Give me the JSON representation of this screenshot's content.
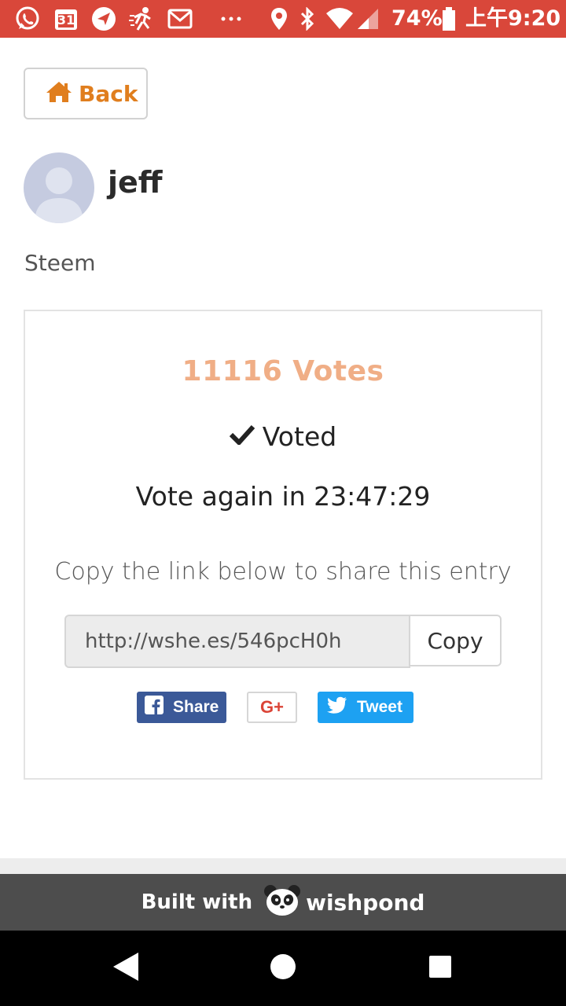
{
  "status_bar": {
    "calendar_day": "31",
    "battery": "74%",
    "time": "上午9:20",
    "icons": [
      "whatsapp-icon",
      "calendar-icon",
      "navigation-icon",
      "running-icon",
      "gmail-icon",
      "more-dots-icon",
      "location-icon",
      "bluetooth-icon",
      "wifi-icon",
      "signal-icon",
      "battery-icon"
    ]
  },
  "header": {
    "back_label": "Back",
    "accent_color": "#e07e1e"
  },
  "profile": {
    "username": "jeff",
    "subtitle": "Steem"
  },
  "entry": {
    "votes_text": "11116 Votes",
    "voted_label": "Voted",
    "vote_again_text": "Vote again in 23:47:29",
    "copy_note": "Copy the link below to share this entry",
    "share_link": "http://wshe.es/546pcH0h",
    "copy_label": "Copy",
    "votes_color": "#f0ae86"
  },
  "share": {
    "facebook_label": "Share",
    "google_label": "G+",
    "twitter_label": "Tweet",
    "facebook_color": "#3b5998",
    "twitter_color": "#1da1f2",
    "google_color": "#db4437"
  },
  "footer": {
    "built_with": "Built with",
    "brand": "wishpond"
  }
}
